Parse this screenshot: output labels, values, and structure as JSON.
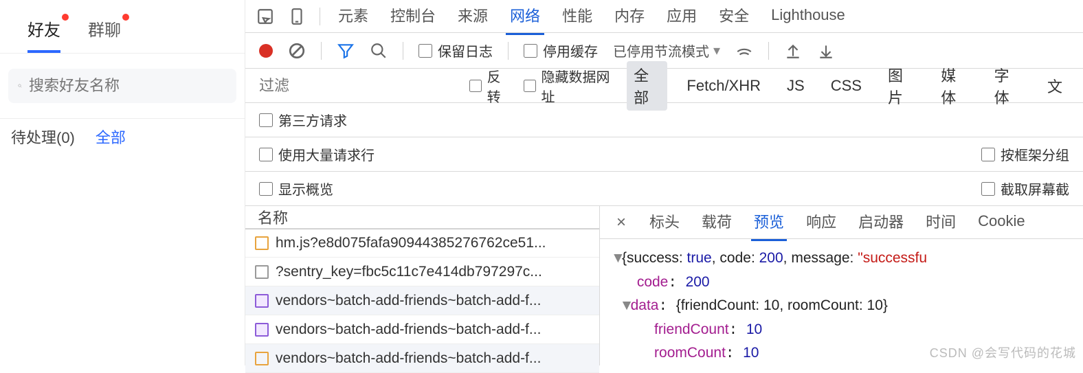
{
  "app": {
    "tabs": {
      "friends": "好友",
      "groups": "群聊"
    },
    "search_placeholder": "搜索好友名称",
    "filters": {
      "pending": "待处理(0)",
      "all": "全部"
    }
  },
  "devtools": {
    "top_tabs": [
      "元素",
      "控制台",
      "来源",
      "网络",
      "性能",
      "内存",
      "应用",
      "安全",
      "Lighthouse"
    ],
    "active_top_tab": "网络",
    "toolbar": {
      "preserve_log": "保留日志",
      "disable_cache": "停用缓存",
      "throttling": "已停用节流模式"
    },
    "filter": {
      "placeholder": "过滤",
      "invert": "反转",
      "hide_data_urls": "隐藏数据网址",
      "types": [
        "全部",
        "Fetch/XHR",
        "JS",
        "CSS",
        "图片",
        "媒体",
        "字体",
        "文"
      ],
      "active_type": "全部",
      "third_party": "第三方请求"
    },
    "settings": {
      "large_rows": "使用大量请求行",
      "group_by_frame": "按框架分组",
      "show_overview": "显示概览",
      "capture_screenshots": "截取屏幕截"
    },
    "list_header": "名称",
    "requests": [
      {
        "icon": "js",
        "name": "hm.js?e8d075fafa90944385276762ce51...",
        "alt": false,
        "cut": true
      },
      {
        "icon": "doc",
        "name": "?sentry_key=fbc5c11c7e414db797297c...",
        "alt": false,
        "cut": false
      },
      {
        "icon": "css",
        "name": "vendors~batch-add-friends~batch-add-f...",
        "alt": true,
        "cut": false
      },
      {
        "icon": "css",
        "name": "vendors~batch-add-friends~batch-add-f...",
        "alt": false,
        "cut": false
      },
      {
        "icon": "js",
        "name": "vendors~batch-add-friends~batch-add-f...",
        "alt": true,
        "cut": false
      }
    ],
    "detail": {
      "tabs": [
        "标头",
        "载荷",
        "预览",
        "响应",
        "启动器",
        "时间",
        "Cookie"
      ],
      "active_tab": "预览",
      "json": {
        "line1_prefix": "{success: ",
        "success": "true",
        "code_label": ", code: ",
        "code": "200",
        "msg_label": ", message: ",
        "msg": "\"successfu",
        "code_k": "code",
        "code_v": "200",
        "data_k": "data",
        "data_inline": "{friendCount: 10, roomCount: 10}",
        "fc_k": "friendCount",
        "fc_v": "10",
        "rc_k": "roomCount",
        "rc_v": "10"
      }
    }
  },
  "watermark": "CSDN @会写代码的花城"
}
